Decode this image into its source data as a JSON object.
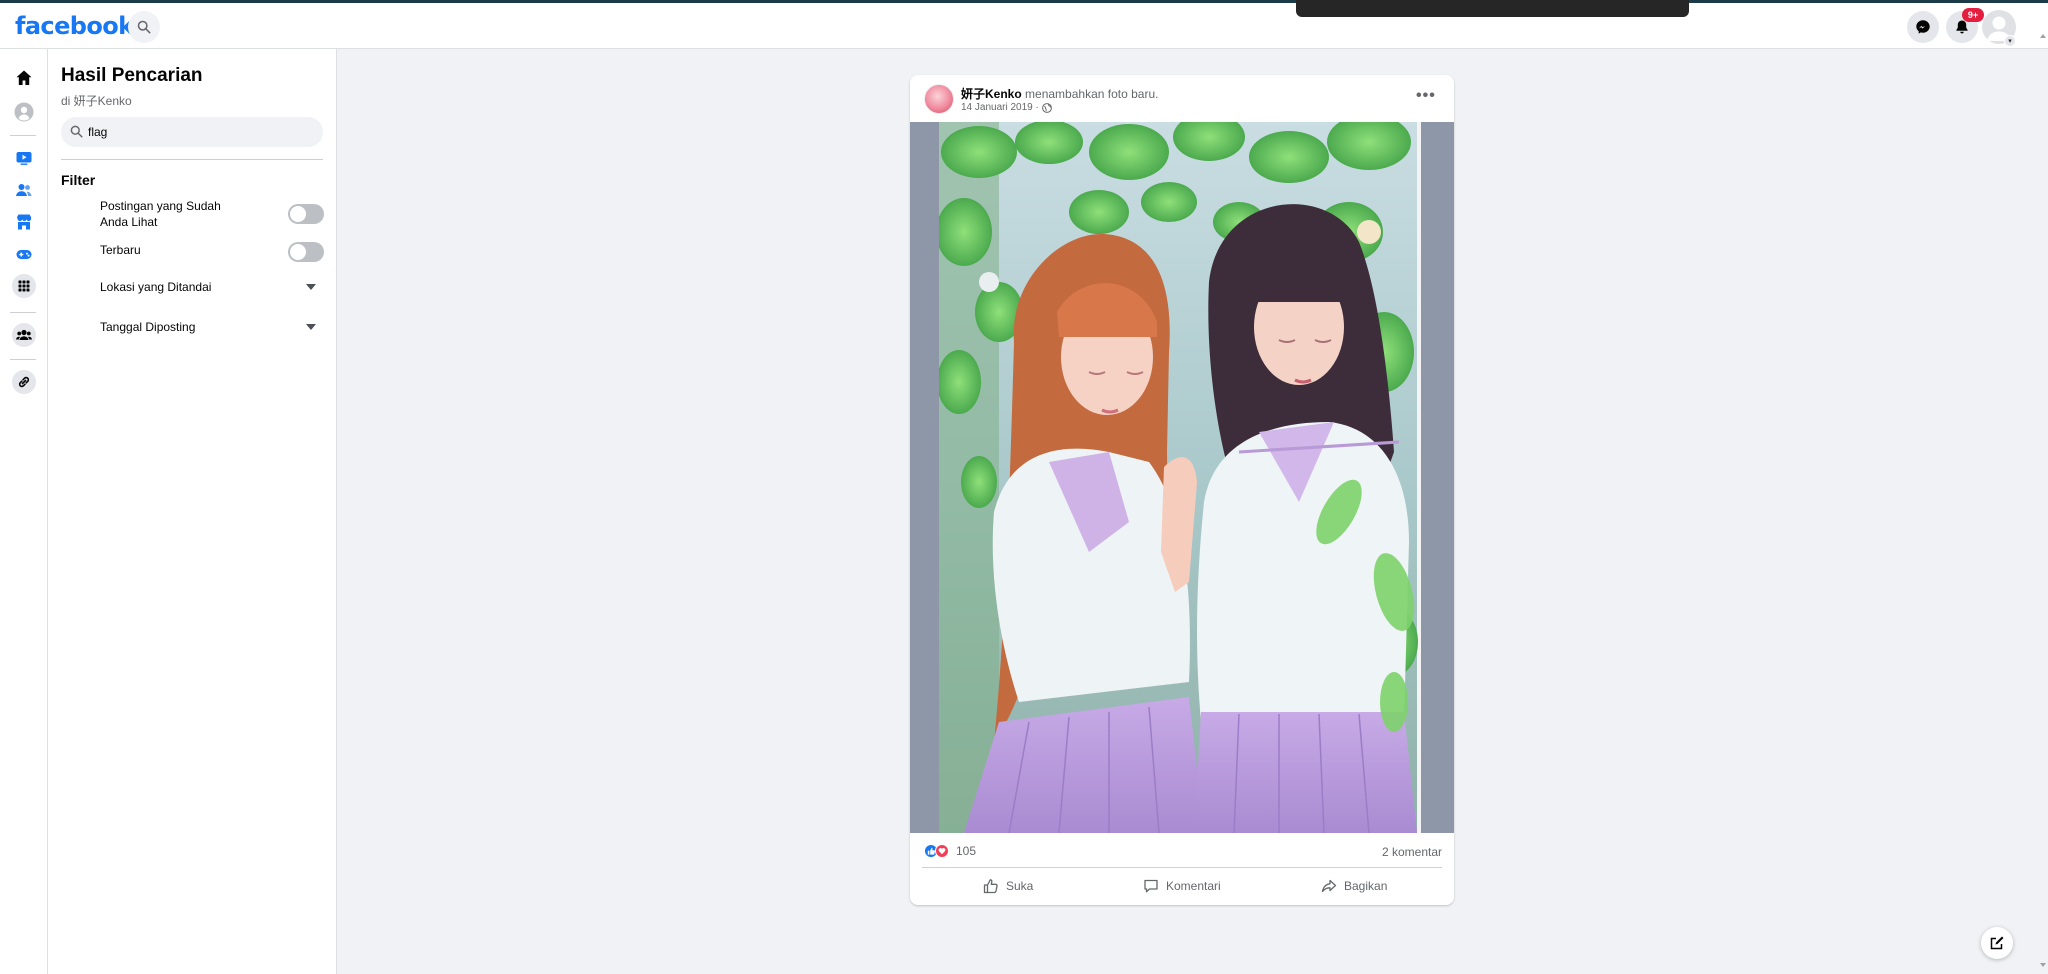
{
  "app": {
    "logo": "facebook",
    "notification_badge": "9+",
    "brand_color": "#1877f2"
  },
  "sidebar": {
    "title": "Hasil Pencarian",
    "subtitle": "di 妍子Kenko",
    "search_value": "flag",
    "filter_heading": "Filter",
    "filters": [
      {
        "label_line1": "Postingan yang Sudah",
        "label_line2": "Anda Lihat",
        "type": "toggle",
        "on": false
      },
      {
        "label": "Terbaru",
        "type": "toggle",
        "on": false
      },
      {
        "label": "Lokasi yang Ditandai",
        "type": "dropdown"
      },
      {
        "label": "Tanggal Diposting",
        "type": "dropdown"
      }
    ]
  },
  "post": {
    "author": "妍子Kenko",
    "action_text": "menambahkan foto baru.",
    "date": "14 Januari 2019 ·",
    "reaction_count": "105",
    "comment_count": "2 komentar",
    "actions": {
      "like": "Suka",
      "comment": "Komentari",
      "share": "Bagikan"
    }
  },
  "icons": {
    "top": [
      "search-icon",
      "messenger-icon",
      "bell-icon",
      "profile-avatar"
    ],
    "left_nav": [
      "home-icon",
      "profile-icon",
      "watch-icon",
      "friends-icon",
      "marketplace-icon",
      "gaming-icon",
      "apps-grid-icon",
      "groups-icon",
      "link-icon"
    ],
    "post": [
      "globe-icon",
      "more-options-icon",
      "like-reaction-icon",
      "love-reaction-icon",
      "thumbs-up-icon",
      "comment-icon",
      "share-icon"
    ],
    "floating": [
      "compose-icon"
    ]
  }
}
